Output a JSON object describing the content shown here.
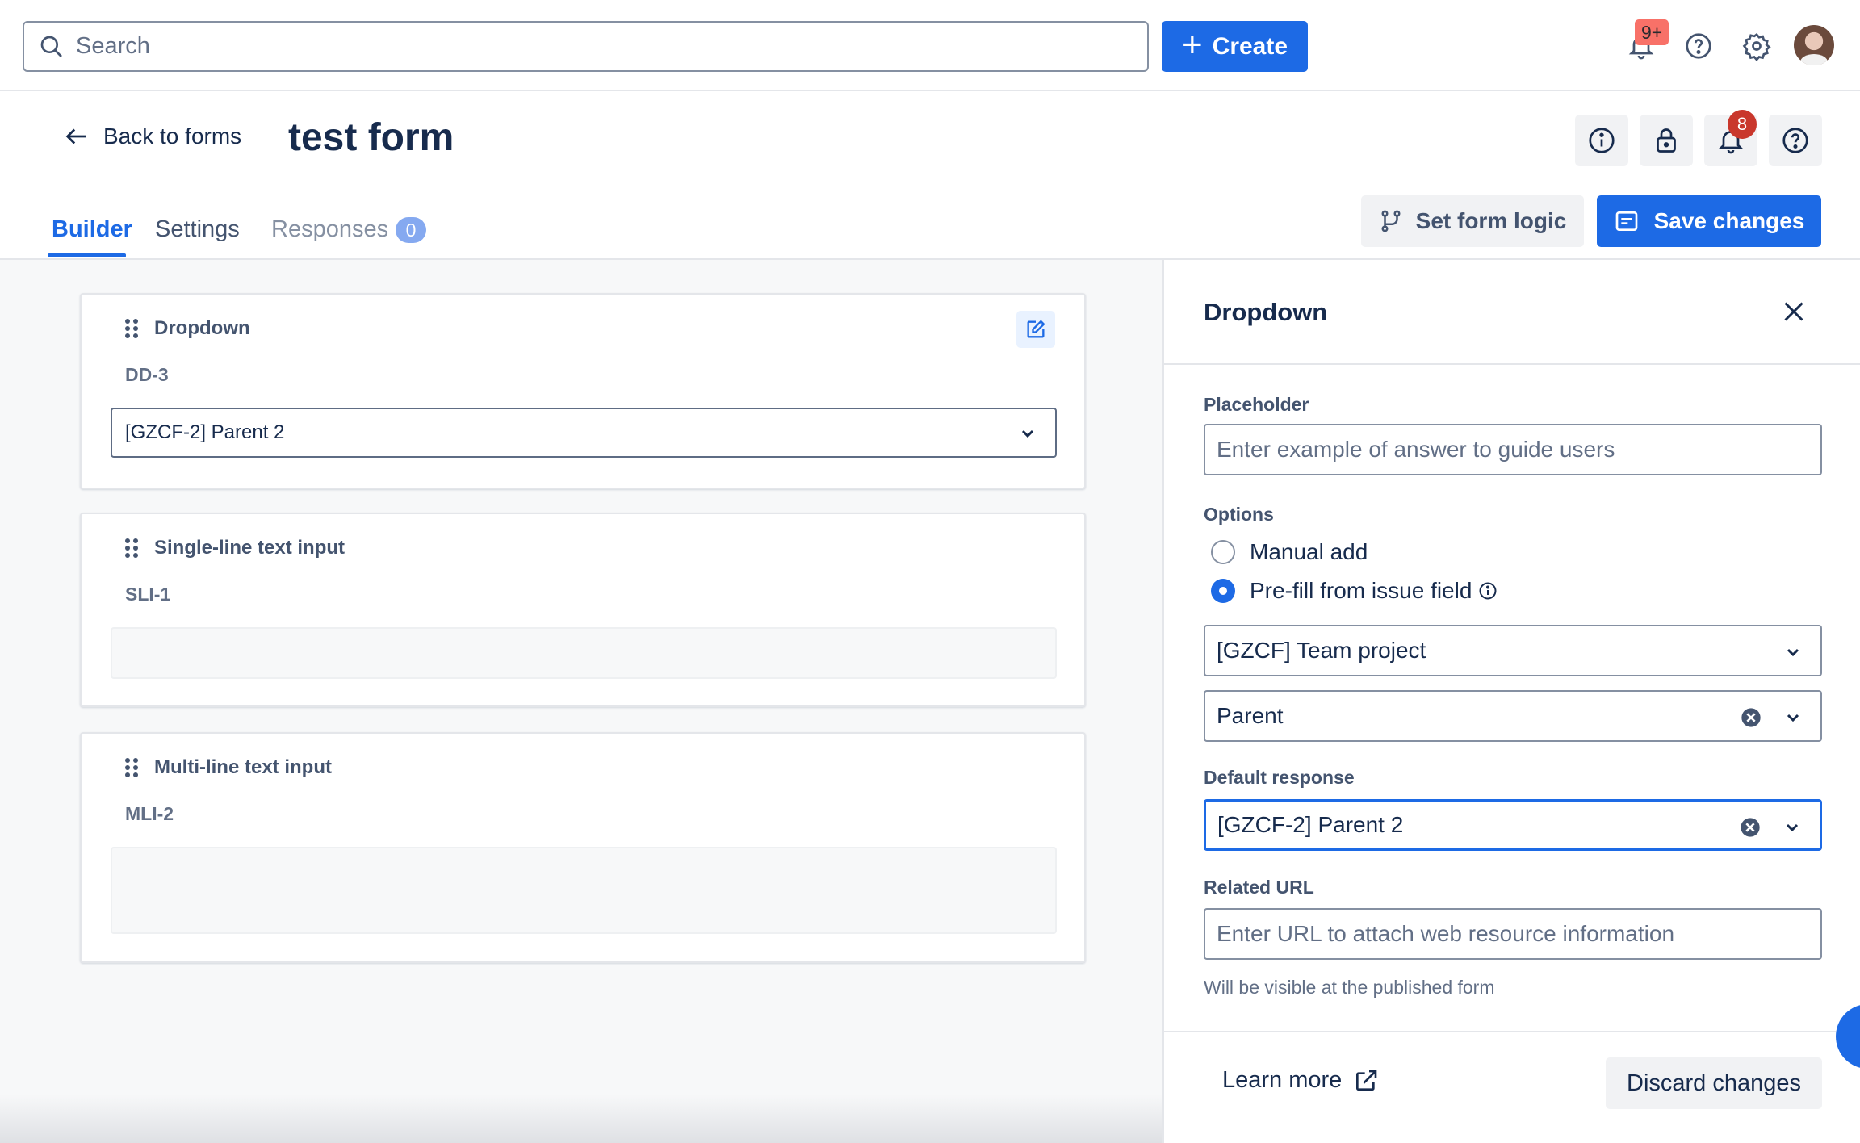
{
  "topnav": {
    "search_placeholder": "Search",
    "create_label": "Create",
    "notifications_badge": "9+",
    "icons": [
      "search-icon",
      "plus-icon",
      "bell-icon",
      "help-icon",
      "gear-icon"
    ]
  },
  "header": {
    "back_label": "Back to forms",
    "title": "test form",
    "notification_count": "8",
    "tabs": [
      {
        "label": "Builder",
        "active": true
      },
      {
        "label": "Settings",
        "active": false
      },
      {
        "label": "Responses",
        "active": false,
        "count": "0"
      }
    ],
    "set_logic_label": "Set form logic",
    "save_label": "Save changes"
  },
  "builder": {
    "cards": [
      {
        "title": "Dropdown",
        "key": "DD-3",
        "value": "[GZCF-2] Parent 2"
      },
      {
        "title": "Single-line text input",
        "key": "SLI-1"
      },
      {
        "title": "Multi-line text input",
        "key": "MLI-2"
      }
    ]
  },
  "panel": {
    "title": "Dropdown",
    "placeholder_label": "Placeholder",
    "placeholder_hint": "Enter example of answer to guide users",
    "options_label": "Options",
    "option_manual": "Manual add",
    "option_prefill": "Pre-fill from issue field",
    "selected_option": "Pre-fill from issue field",
    "project_value": "[GZCF] Team project",
    "field_value": "Parent",
    "default_label": "Default response",
    "default_value": "[GZCF-2] Parent 2",
    "url_label": "Related URL",
    "url_hint": "Enter URL to attach web resource information",
    "url_help": "Will be visible at the published form",
    "learn_more": "Learn more",
    "discard_label": "Discard changes"
  },
  "colors": {
    "primary": "#1d6ae5",
    "badge_red": "#c9372c",
    "badge_salmon": "#f87168",
    "canvas_bg": "#f7f8f9"
  }
}
